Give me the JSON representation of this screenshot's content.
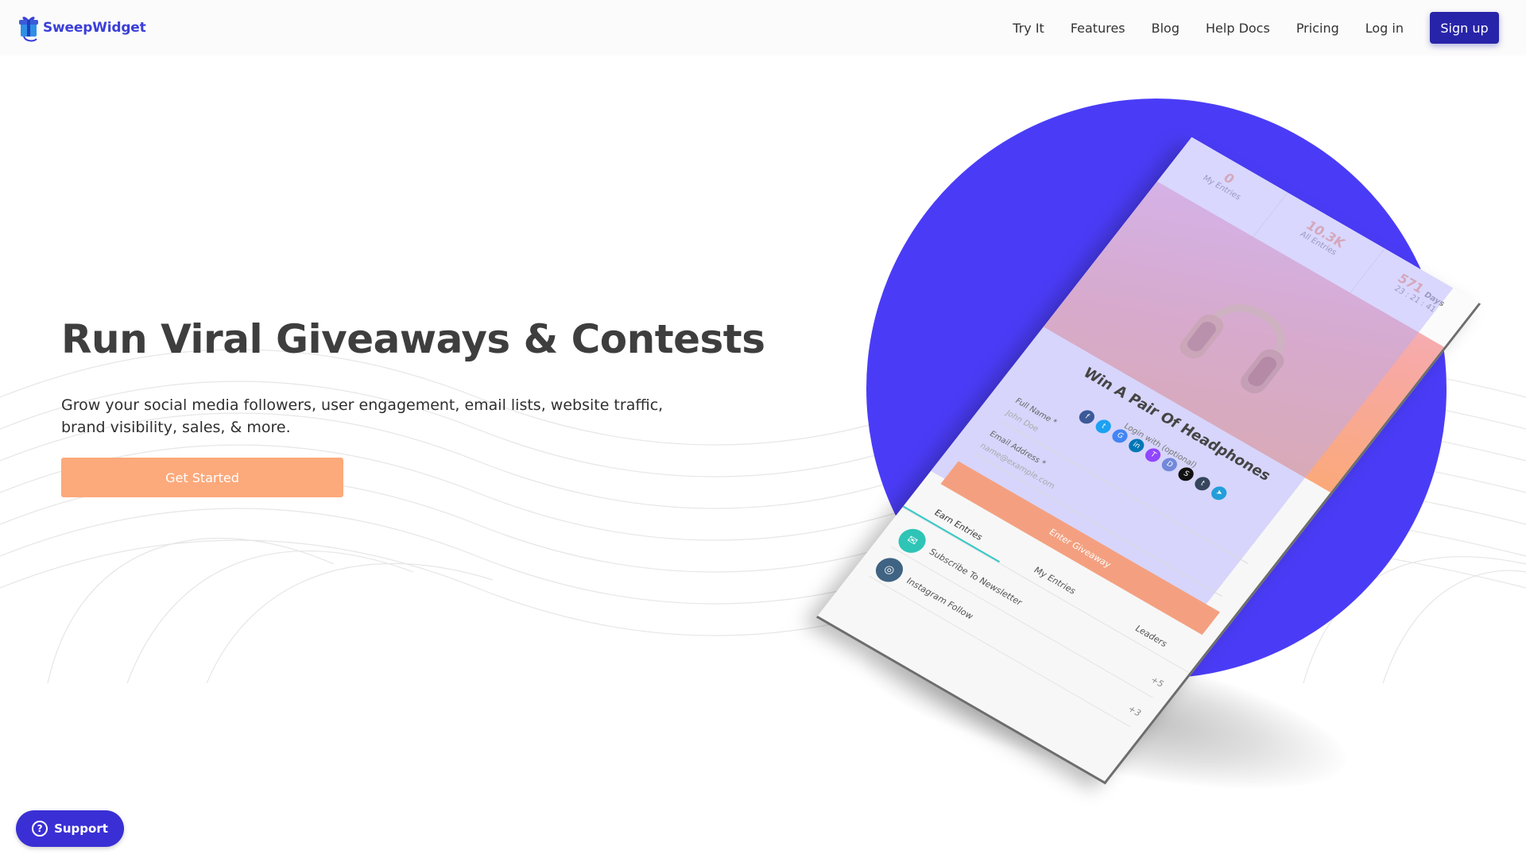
{
  "brand": {
    "name": "SweepWidget",
    "logo_icon": "gift-icon",
    "primary_color": "#2824a9",
    "accent_color": "#4a3cf6",
    "cta_color": "#fca97b"
  },
  "nav": {
    "items": [
      {
        "label": "Try It"
      },
      {
        "label": "Features"
      },
      {
        "label": "Blog"
      },
      {
        "label": "Help Docs"
      },
      {
        "label": "Pricing"
      },
      {
        "label": "Log in"
      }
    ],
    "signup_label": "Sign up"
  },
  "hero": {
    "title": "Run Viral Giveaways & Contests",
    "subtitle": "Grow your social media followers, user engagement, email lists, website traffic, brand visibility, sales, & more.",
    "cta_label": "Get Started"
  },
  "widget": {
    "stats": [
      {
        "value": "0",
        "label": "My Entries"
      },
      {
        "value": "10.3K",
        "label": "All Entries"
      },
      {
        "value": "571",
        "label": "Days",
        "sub": "23 : 21 : 41"
      }
    ],
    "title": "Win A Pair Of Headphones",
    "login_label": "Login with (optional)",
    "social_icons": [
      {
        "name": "facebook-icon",
        "glyph": "f",
        "color": "#3b5998"
      },
      {
        "name": "twitter-icon",
        "glyph": "t",
        "color": "#1da1f2"
      },
      {
        "name": "google-icon",
        "glyph": "G",
        "color": "#4285f4"
      },
      {
        "name": "linkedin-icon",
        "glyph": "in",
        "color": "#0077b5"
      },
      {
        "name": "twitch-icon",
        "glyph": "T",
        "color": "#9146ff"
      },
      {
        "name": "discord-icon",
        "glyph": "D",
        "color": "#7289da"
      },
      {
        "name": "steam-icon",
        "glyph": "S",
        "color": "#111111"
      },
      {
        "name": "tumblr-icon",
        "glyph": "t",
        "color": "#35465c"
      },
      {
        "name": "telegram-icon",
        "glyph": "➤",
        "color": "#229ed9"
      }
    ],
    "full_name_label": "Full Name *",
    "full_name_placeholder": "John Doe",
    "email_label": "Email Address *",
    "email_placeholder": "name@example.com",
    "enter_label": "Enter Giveaway",
    "tabs": [
      {
        "label": "Earn Entries",
        "active": true
      },
      {
        "label": "My Entries",
        "active": false
      },
      {
        "label": "Leaders",
        "active": false
      }
    ],
    "entries": [
      {
        "label": "Subscribe To Newsletter",
        "points": "+5",
        "icon": "envelope-icon",
        "color": "#2ec4b6"
      },
      {
        "label": "Instagram Follow",
        "points": "+3",
        "icon": "instagram-icon",
        "color": "#3f6382"
      }
    ]
  },
  "support": {
    "label": "Support",
    "icon": "question-circle-icon"
  }
}
